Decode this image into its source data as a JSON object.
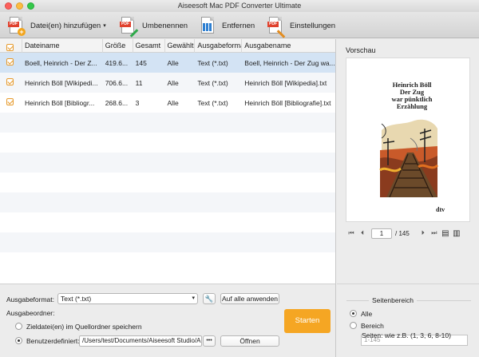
{
  "window": {
    "title": "Aiseesoft Mac PDF Converter Ultimate"
  },
  "toolbar": {
    "add_label": "Datei(en) hinzufügen",
    "rename_label": "Umbenennen",
    "remove_label": "Entfernen",
    "settings_label": "Einstellungen"
  },
  "table": {
    "columns": [
      "Dateiname",
      "Größe",
      "Gesamt",
      "Gewählt",
      "Ausgabeformat",
      "Ausgabename"
    ],
    "rows": [
      {
        "name": "Boell, Heinrich - Der Z...",
        "size": "419.6...",
        "total": "145",
        "selected": "Alle",
        "format": "Text (*.txt)",
        "output": "Boell, Heinrich - Der Zug wa..."
      },
      {
        "name": "Heinrich Böll [Wikipedi...",
        "size": "706.6...",
        "total": "11",
        "selected": "Alle",
        "format": "Text (*.txt)",
        "output": "Heinrich Böll [Wikipedia].txt"
      },
      {
        "name": "Heinrich Böll [Bibliogr...",
        "size": "268.6...",
        "total": "3",
        "selected": "Alle",
        "format": "Text (*.txt)",
        "output": "Heinrich Böll [Bibliografie].txt"
      }
    ]
  },
  "settings": {
    "format_label": "Ausgabeformat:",
    "format_value": "Text (*.txt)",
    "apply_all": "Auf alle anwenden",
    "output_folder_label": "Ausgabeordner:",
    "source_folder_option": "Zieldatei(en) im Quellordner speichern",
    "custom_option": "Benutzerdefiniert:",
    "custom_path": "/Users/test/Documents/Aiseesoft Studio/Ai",
    "browse": "•••",
    "open": "Öffnen",
    "start": "Starten"
  },
  "preview": {
    "title": "Vorschau",
    "cover_title": "Heinrich Böll\nDer Zug\nwar pünktlich\nErzählung",
    "cover_brand": "dtv",
    "current_page": "1",
    "total_pages": "/ 145"
  },
  "page_range": {
    "title": "Seitenbereich",
    "all": "Alle",
    "range": "Bereich",
    "range_placeholder": "1-145",
    "hint": "Seiten: wie z.B. (1, 3, 6, 8-10)"
  },
  "colors": {
    "accent": "#f5a623",
    "selection": "#d3e3f4"
  }
}
